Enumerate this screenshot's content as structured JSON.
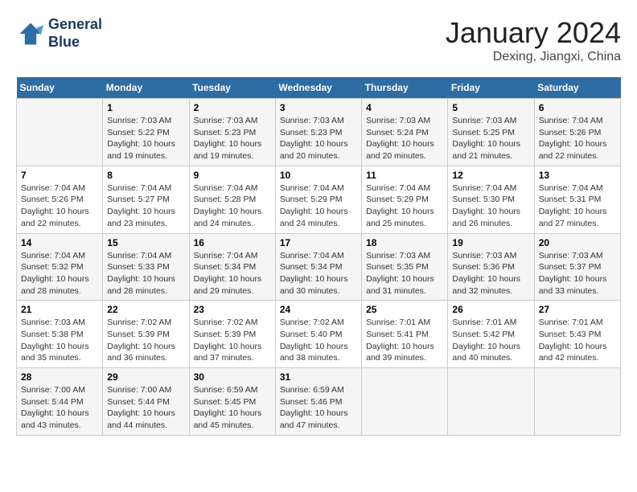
{
  "header": {
    "logo_line1": "General",
    "logo_line2": "Blue",
    "month_title": "January 2024",
    "location": "Dexing, Jiangxi, China"
  },
  "weekdays": [
    "Sunday",
    "Monday",
    "Tuesday",
    "Wednesday",
    "Thursday",
    "Friday",
    "Saturday"
  ],
  "weeks": [
    [
      {
        "day": "",
        "info": ""
      },
      {
        "day": "1",
        "info": "Sunrise: 7:03 AM\nSunset: 5:22 PM\nDaylight: 10 hours\nand 19 minutes."
      },
      {
        "day": "2",
        "info": "Sunrise: 7:03 AM\nSunset: 5:23 PM\nDaylight: 10 hours\nand 19 minutes."
      },
      {
        "day": "3",
        "info": "Sunrise: 7:03 AM\nSunset: 5:23 PM\nDaylight: 10 hours\nand 20 minutes."
      },
      {
        "day": "4",
        "info": "Sunrise: 7:03 AM\nSunset: 5:24 PM\nDaylight: 10 hours\nand 20 minutes."
      },
      {
        "day": "5",
        "info": "Sunrise: 7:03 AM\nSunset: 5:25 PM\nDaylight: 10 hours\nand 21 minutes."
      },
      {
        "day": "6",
        "info": "Sunrise: 7:04 AM\nSunset: 5:26 PM\nDaylight: 10 hours\nand 22 minutes."
      }
    ],
    [
      {
        "day": "7",
        "info": "Sunrise: 7:04 AM\nSunset: 5:26 PM\nDaylight: 10 hours\nand 22 minutes."
      },
      {
        "day": "8",
        "info": "Sunrise: 7:04 AM\nSunset: 5:27 PM\nDaylight: 10 hours\nand 23 minutes."
      },
      {
        "day": "9",
        "info": "Sunrise: 7:04 AM\nSunset: 5:28 PM\nDaylight: 10 hours\nand 24 minutes."
      },
      {
        "day": "10",
        "info": "Sunrise: 7:04 AM\nSunset: 5:29 PM\nDaylight: 10 hours\nand 24 minutes."
      },
      {
        "day": "11",
        "info": "Sunrise: 7:04 AM\nSunset: 5:29 PM\nDaylight: 10 hours\nand 25 minutes."
      },
      {
        "day": "12",
        "info": "Sunrise: 7:04 AM\nSunset: 5:30 PM\nDaylight: 10 hours\nand 26 minutes."
      },
      {
        "day": "13",
        "info": "Sunrise: 7:04 AM\nSunset: 5:31 PM\nDaylight: 10 hours\nand 27 minutes."
      }
    ],
    [
      {
        "day": "14",
        "info": "Sunrise: 7:04 AM\nSunset: 5:32 PM\nDaylight: 10 hours\nand 28 minutes."
      },
      {
        "day": "15",
        "info": "Sunrise: 7:04 AM\nSunset: 5:33 PM\nDaylight: 10 hours\nand 28 minutes."
      },
      {
        "day": "16",
        "info": "Sunrise: 7:04 AM\nSunset: 5:34 PM\nDaylight: 10 hours\nand 29 minutes."
      },
      {
        "day": "17",
        "info": "Sunrise: 7:04 AM\nSunset: 5:34 PM\nDaylight: 10 hours\nand 30 minutes."
      },
      {
        "day": "18",
        "info": "Sunrise: 7:03 AM\nSunset: 5:35 PM\nDaylight: 10 hours\nand 31 minutes."
      },
      {
        "day": "19",
        "info": "Sunrise: 7:03 AM\nSunset: 5:36 PM\nDaylight: 10 hours\nand 32 minutes."
      },
      {
        "day": "20",
        "info": "Sunrise: 7:03 AM\nSunset: 5:37 PM\nDaylight: 10 hours\nand 33 minutes."
      }
    ],
    [
      {
        "day": "21",
        "info": "Sunrise: 7:03 AM\nSunset: 5:38 PM\nDaylight: 10 hours\nand 35 minutes."
      },
      {
        "day": "22",
        "info": "Sunrise: 7:02 AM\nSunset: 5:39 PM\nDaylight: 10 hours\nand 36 minutes."
      },
      {
        "day": "23",
        "info": "Sunrise: 7:02 AM\nSunset: 5:39 PM\nDaylight: 10 hours\nand 37 minutes."
      },
      {
        "day": "24",
        "info": "Sunrise: 7:02 AM\nSunset: 5:40 PM\nDaylight: 10 hours\nand 38 minutes."
      },
      {
        "day": "25",
        "info": "Sunrise: 7:01 AM\nSunset: 5:41 PM\nDaylight: 10 hours\nand 39 minutes."
      },
      {
        "day": "26",
        "info": "Sunrise: 7:01 AM\nSunset: 5:42 PM\nDaylight: 10 hours\nand 40 minutes."
      },
      {
        "day": "27",
        "info": "Sunrise: 7:01 AM\nSunset: 5:43 PM\nDaylight: 10 hours\nand 42 minutes."
      }
    ],
    [
      {
        "day": "28",
        "info": "Sunrise: 7:00 AM\nSunset: 5:44 PM\nDaylight: 10 hours\nand 43 minutes."
      },
      {
        "day": "29",
        "info": "Sunrise: 7:00 AM\nSunset: 5:44 PM\nDaylight: 10 hours\nand 44 minutes."
      },
      {
        "day": "30",
        "info": "Sunrise: 6:59 AM\nSunset: 5:45 PM\nDaylight: 10 hours\nand 45 minutes."
      },
      {
        "day": "31",
        "info": "Sunrise: 6:59 AM\nSunset: 5:46 PM\nDaylight: 10 hours\nand 47 minutes."
      },
      {
        "day": "",
        "info": ""
      },
      {
        "day": "",
        "info": ""
      },
      {
        "day": "",
        "info": ""
      }
    ]
  ]
}
